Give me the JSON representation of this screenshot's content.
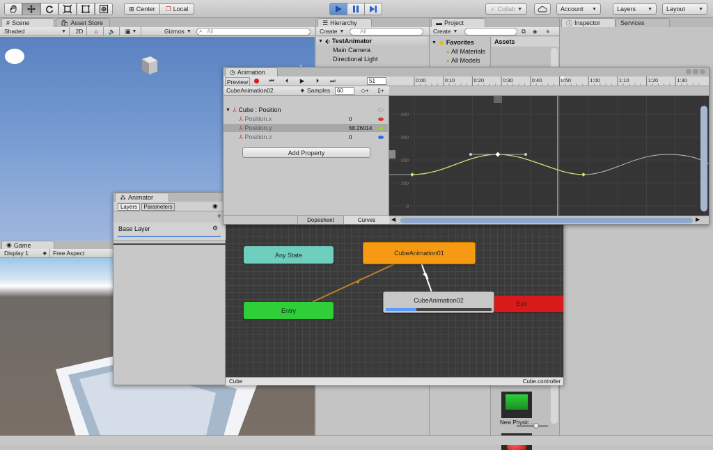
{
  "toolbar": {
    "pivot_label": "Center",
    "space_label": "Local",
    "collab_label": "Collab",
    "account_label": "Account",
    "layers_label": "Layers",
    "layout_label": "Layout"
  },
  "scene": {
    "tab_scene": "Scene",
    "tab_asset_store": "Asset Store",
    "shading_mode": "Shaded",
    "mode_2d": "2D",
    "gizmos_label": "Gizmos",
    "search_placeholder": "All",
    "axis_x": "x",
    "axis_y": "y",
    "axis_z": "z"
  },
  "hierarchy": {
    "tab": "Hierarchy",
    "create_label": "Create",
    "search_placeholder": "All",
    "scene_name": "TestAnimator",
    "items": [
      "Main Camera",
      "Directional Light"
    ]
  },
  "project": {
    "tab": "Project",
    "create_label": "Create",
    "favorites_label": "Favorites",
    "favorites_items": [
      "All Materials",
      "All Models"
    ],
    "assets_header": "Assets",
    "asset_label": "New Physic ..."
  },
  "inspector": {
    "tab_inspector": "Inspector",
    "tab_services": "Services"
  },
  "animation": {
    "tab": "Animation",
    "preview_label": "Preview",
    "frame_value": "51",
    "clip_name": "CubeAnimation02",
    "samples_label": "Samples",
    "samples_value": "60",
    "timeline_ticks": [
      "0:00",
      "0:10",
      "0:20",
      "0:30",
      "0:40",
      "0:50",
      "1:00",
      "1:10",
      "1:20",
      "1:30"
    ],
    "y_ticks": [
      "400",
      "300",
      "200",
      "100",
      "0",
      "-100"
    ],
    "group_label": "Cube : Position",
    "properties": [
      {
        "name": "Position.x",
        "value": "0",
        "color": "#d83a2a"
      },
      {
        "name": "Position.y",
        "value": "68.26014",
        "color": "#9acd32"
      },
      {
        "name": "Position.z",
        "value": "0",
        "color": "#2a6fd8"
      }
    ],
    "add_property_label": "Add Property",
    "view_tab_dopesheet": "Dopesheet",
    "view_tab_curves": "Curves",
    "curve_color": "#c8e87a"
  },
  "game": {
    "tab": "Game",
    "display_label": "Display 1",
    "aspect_label": "Free Aspect"
  },
  "animator": {
    "tab": "Animator",
    "tab_layers": "Layers",
    "tab_parameters": "Parameters",
    "base_layer": "Base Layer",
    "breadcrumb": "Cube",
    "controller_name": "Cube.controller",
    "states": [
      {
        "id": "any-state",
        "label": "Any State",
        "color": "#6ecfbf"
      },
      {
        "id": "entry",
        "label": "Entry",
        "color": "#2fcf3a"
      },
      {
        "id": "cubeanimation01",
        "label": "CubeAnimation01",
        "color": "#f59a12"
      },
      {
        "id": "cubeanimation02",
        "label": "CubeAnimation02",
        "color": "#c8c8c8"
      },
      {
        "id": "exit",
        "label": "Exit",
        "color": "#d91a1a"
      }
    ],
    "cubeanimation02_progress": 0.29
  }
}
